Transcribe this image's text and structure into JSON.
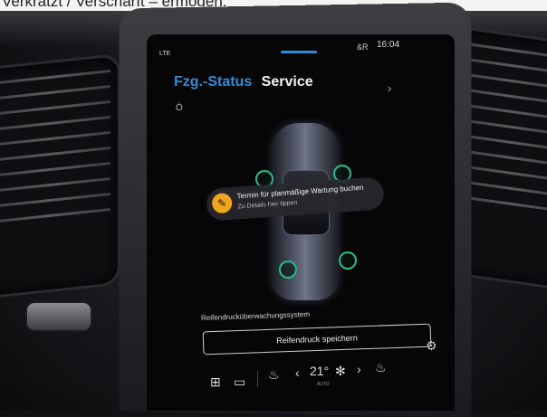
{
  "caption_fragment": "Verkratzt / Verschärft – ermöden.",
  "status_bar": {
    "network": "LTE",
    "clock_label": "&R",
    "time": "16:04"
  },
  "tabs": [
    {
      "label": "Fzg.-Status",
      "active": true
    },
    {
      "label": "Service",
      "active": false
    }
  ],
  "notification": {
    "title": "Termin für planmäßige Wartung buchen",
    "subtitle": "Zu Details hier tippen",
    "icon": "wrench-icon"
  },
  "tpms": {
    "label": "Reifendrucküberwachungssystem",
    "button_label": "Reifendruck speichern"
  },
  "climate": {
    "temperature": "21°",
    "mode": "AUTO"
  },
  "colors": {
    "accent": "#2f8cd6",
    "wheel_ok": "#22c08a",
    "notification_icon": "#f1a51d"
  }
}
